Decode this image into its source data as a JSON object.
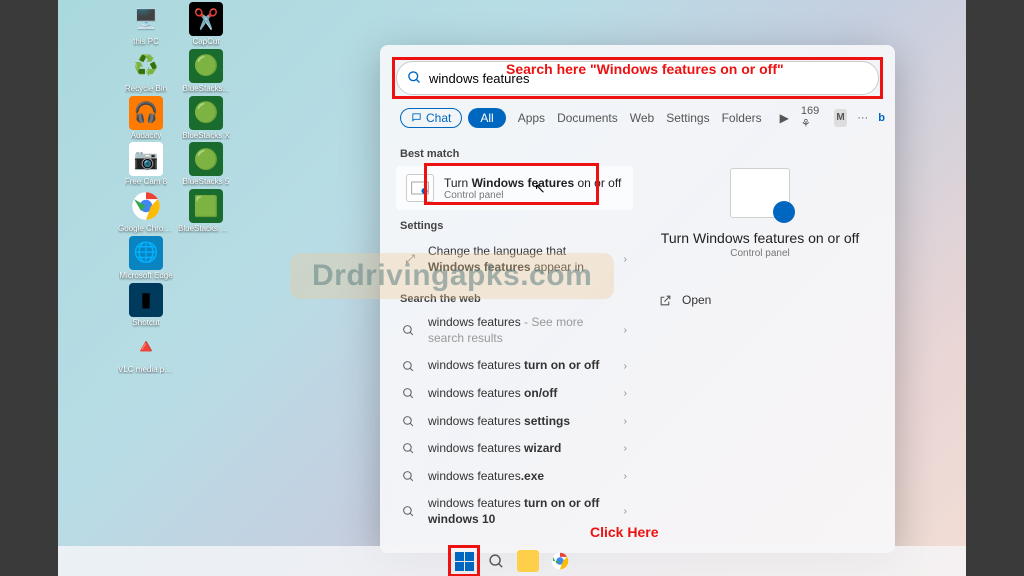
{
  "desktop": {
    "icons": [
      [
        {
          "label": "this PC",
          "g": "🖥️",
          "bg": ""
        },
        {
          "label": "CapCut",
          "g": "✂️",
          "bg": "#000"
        }
      ],
      [
        {
          "label": "Recycle Bin",
          "g": "♻️",
          "bg": ""
        },
        {
          "label": "BlueStacks...",
          "g": "🟢",
          "bg": "#1a6b2e"
        }
      ],
      [
        {
          "label": "Audacity",
          "g": "🎧",
          "bg": "#ff7a00"
        },
        {
          "label": "BlueStacks X",
          "g": "🟢",
          "bg": "#1a6b2e"
        }
      ],
      [
        {
          "label": "Free Cam 8",
          "g": "📷",
          "bg": "#fff"
        },
        {
          "label": "BlueStacks 5",
          "g": "🟢",
          "bg": "#1a6b2e"
        }
      ],
      [
        {
          "label": "Google Chrome",
          "g": "",
          "bg": "",
          "chrome": true
        },
        {
          "label": "BlueStacks Multi-Insta...",
          "g": "🟩",
          "bg": "#1a6b2e"
        }
      ],
      [
        {
          "label": "Microsoft Edge",
          "g": "🌐",
          "bg": "#0a84c1"
        },
        null
      ],
      [
        {
          "label": "Shotcut",
          "g": "▮",
          "bg": "#003a5c"
        },
        null
      ],
      [
        {
          "label": "VLC media player",
          "g": "🔺",
          "bg": ""
        },
        null
      ]
    ]
  },
  "search": {
    "value": "windows features",
    "annotation": "Search here \"Windows features on or off\""
  },
  "tabs": {
    "chat": "Chat",
    "all": "All",
    "items": [
      "Apps",
      "Documents",
      "Web",
      "Settings",
      "Folders"
    ],
    "points": "169",
    "user_initial": "M"
  },
  "sections": {
    "best": "Best match",
    "settings": "Settings",
    "web": "Search the web"
  },
  "best_match": {
    "title_pre": "Turn ",
    "title_bold": "Windows features",
    "title_post": " on or off",
    "sub": "Control panel"
  },
  "settings_results": [
    {
      "pre": "Change the language that ",
      "bold": "Windows features",
      "post": " appear in"
    }
  ],
  "web_results": [
    {
      "pre": "windows features",
      "post": " - See more search results",
      "muted": true
    },
    {
      "pre": "windows features ",
      "bold": "turn on or off"
    },
    {
      "pre": "windows features ",
      "bold": "on/off"
    },
    {
      "pre": "windows features ",
      "bold": "settings"
    },
    {
      "pre": "windows features ",
      "bold": "wizard"
    },
    {
      "pre": "windows features",
      "bold": ".exe"
    },
    {
      "pre": "windows features ",
      "bold": "turn on or off windows 10"
    }
  ],
  "preview": {
    "title": "Turn Windows features on or off",
    "sub": "Control panel",
    "open": "Open"
  },
  "watermark": "Drdrivingapks.com",
  "taskbar_annotation": "Click Here"
}
